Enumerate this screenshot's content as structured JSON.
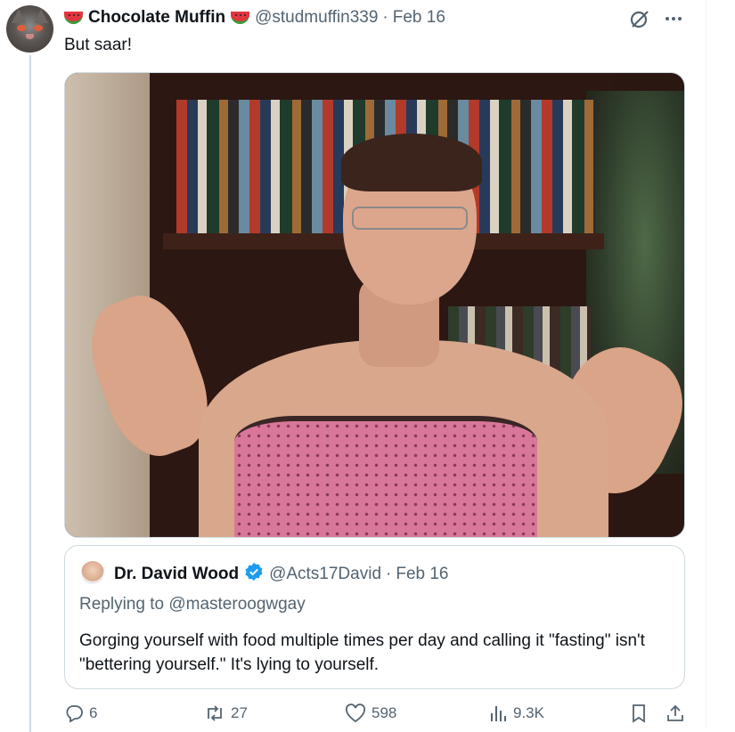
{
  "tweet": {
    "display_name": "Chocolate Muffin",
    "handle": "@studmuffin339",
    "separator": "·",
    "date": "Feb 16",
    "text": "But saar!"
  },
  "quoted_tweet": {
    "display_name": "Dr. David Wood",
    "handle": "@Acts17David",
    "separator": "·",
    "date": "Feb 16",
    "replying_to": "Replying to @masteroogwgay",
    "text": "Gorging yourself with food multiple times per day and calling it \"fasting\" isn't \"bettering yourself.\" It's lying to yourself."
  },
  "actions": {
    "replies": "6",
    "reposts": "27",
    "likes": "598",
    "views": "9.3K"
  },
  "icons": {
    "name_emoji": "watermelon-icon",
    "top_right": [
      "grok-icon",
      "more-icon"
    ],
    "verified": "verified-badge-icon",
    "action_icons": [
      "reply-icon",
      "repost-icon",
      "like-icon",
      "views-icon",
      "bookmark-icon",
      "share-icon"
    ]
  },
  "colors": {
    "text_primary": "#0f1419",
    "text_secondary": "#536471",
    "border": "#cfd9de",
    "verified_blue": "#1d9bf0"
  }
}
